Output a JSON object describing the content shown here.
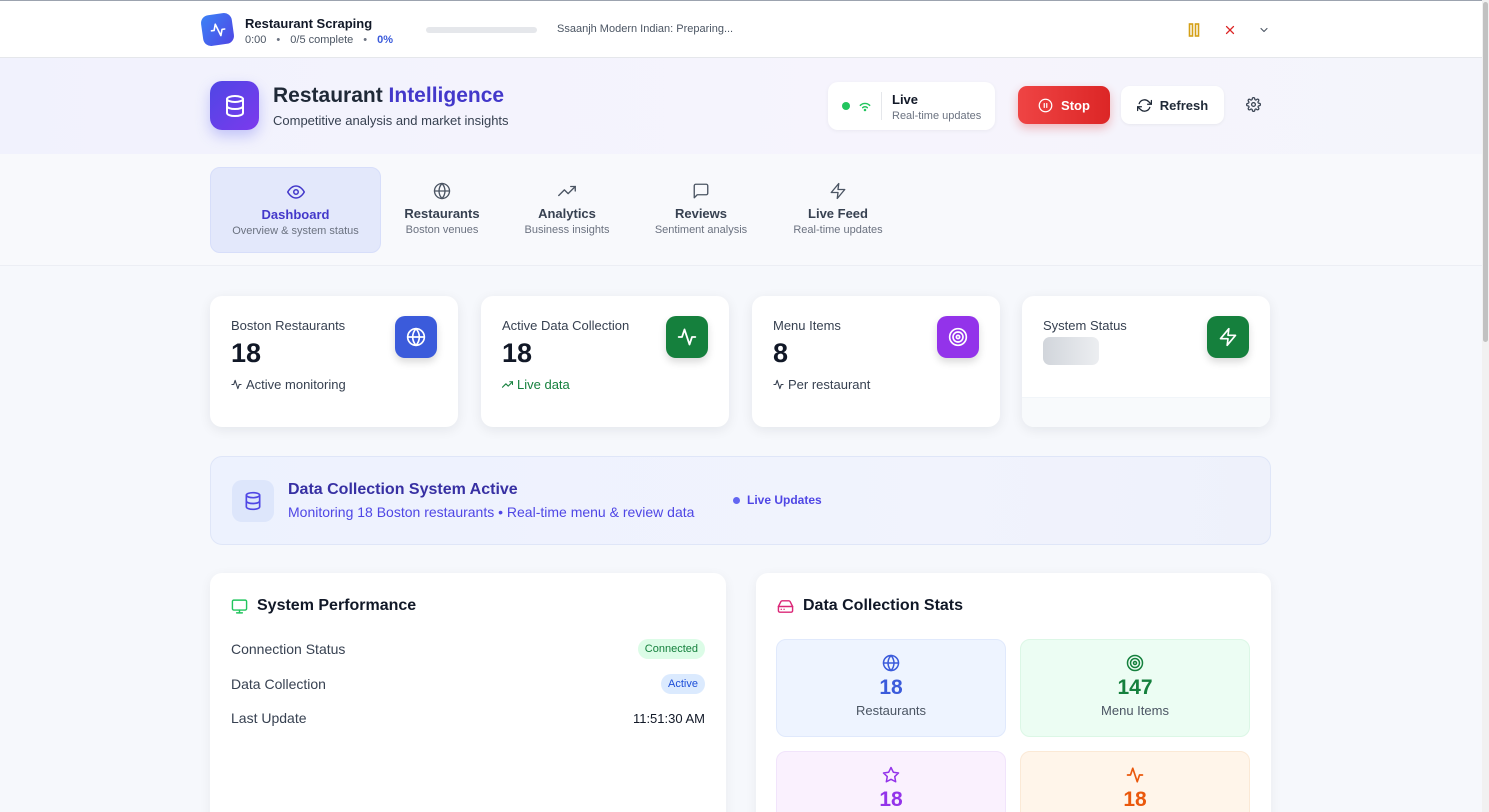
{
  "scraper": {
    "title": "Restaurant Scraping",
    "elapsed": "0:00",
    "complete": "0/5 complete",
    "percent": "0%",
    "progress_fraction": 0,
    "status": "Ssaanjh Modern Indian: Preparing..."
  },
  "header": {
    "brand_part1": "Restaurant ",
    "brand_part2": "Intelligence",
    "subtitle": "Competitive analysis and market insights",
    "live_title": "Live",
    "live_subtitle": "Real-time updates",
    "stop_label": "Stop",
    "refresh_label": "Refresh"
  },
  "tabs": [
    {
      "label": "Dashboard",
      "sub": "Overview & system status",
      "icon": "eye-icon",
      "active": true
    },
    {
      "label": "Restaurants",
      "sub": "Boston venues",
      "icon": "globe-icon"
    },
    {
      "label": "Analytics",
      "sub": "Business insights",
      "icon": "trending-up-icon"
    },
    {
      "label": "Reviews",
      "sub": "Sentiment analysis",
      "icon": "message-square-icon"
    },
    {
      "label": "Live Feed",
      "sub": "Real-time updates",
      "icon": "zap-icon"
    }
  ],
  "cards": [
    {
      "label": "Boston Restaurants",
      "value": "18",
      "note": "Active monitoring",
      "icon": "globe-icon",
      "color": "#3b5bdb"
    },
    {
      "label": "Active Data Collection",
      "value": "18",
      "note": "Live data",
      "icon": "activity-icon",
      "color": "#15803d"
    },
    {
      "label": "Menu Items",
      "value": "8",
      "note": "Per restaurant",
      "icon": "target-icon",
      "color": "#9333ea"
    },
    {
      "label": "System Status",
      "icon": "zap-icon",
      "color": "#15803d"
    }
  ],
  "banner": {
    "title": "Data Collection System Active",
    "subtitle": "Monitoring 18 Boston restaurants • Real-time menu & review data",
    "live": "Live Updates"
  },
  "performance": {
    "title": "System Performance",
    "rows": [
      {
        "label": "Connection Status",
        "value": "Connected"
      },
      {
        "label": "Data Collection",
        "value": "Active"
      },
      {
        "label": "Last Update",
        "value": "11:51:30 AM"
      }
    ]
  },
  "stats": {
    "title": "Data Collection Stats",
    "items": [
      {
        "value": "18",
        "label": "Restaurants",
        "icon": "globe-icon",
        "color": "#3b5bdb",
        "bg": "#eef4ff"
      },
      {
        "value": "147",
        "label": "Menu Items",
        "icon": "target-icon",
        "color": "#15803d",
        "bg": "#ecfdf3"
      },
      {
        "value": "18",
        "label": "",
        "icon": "star-icon",
        "color": "#9333ea",
        "bg": "#faf1fe"
      },
      {
        "value": "18",
        "label": "",
        "icon": "activity-icon",
        "color": "#ea580c",
        "bg": "#fff5ea"
      }
    ]
  },
  "colors": {
    "accent": "#4338ca",
    "stop": "#dc2626",
    "live": "#22c55e"
  }
}
